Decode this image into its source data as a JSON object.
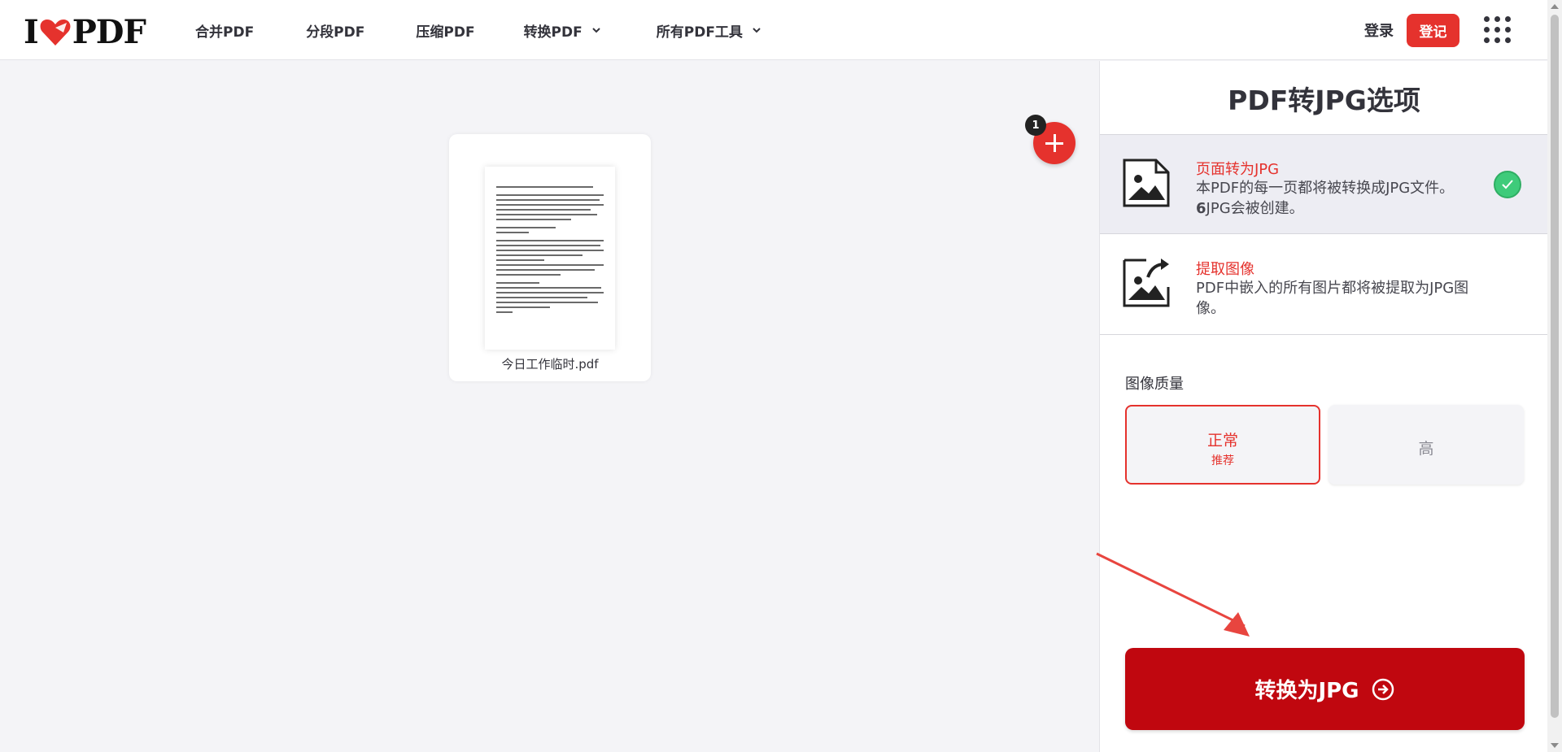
{
  "header": {
    "logo": {
      "left": "I",
      "right": "PDF"
    },
    "nav": [
      {
        "label": "合并PDF",
        "dropdown": false
      },
      {
        "label": "分段PDF",
        "dropdown": false
      },
      {
        "label": "压缩PDF",
        "dropdown": false
      },
      {
        "label": "转换PDF",
        "dropdown": true
      },
      {
        "label": "所有PDF工具",
        "dropdown": true
      }
    ],
    "login_label": "登录",
    "signup_label": "登记"
  },
  "workspace": {
    "file_name": "今日工作临时.pdf",
    "file_count_badge": "1"
  },
  "sidebar": {
    "title": "PDF转JPG选项",
    "options": [
      {
        "title": "页面转为JPG",
        "desc_prefix": "本PDF的每一页都将被转换成JPG文件。",
        "desc_count": "6",
        "desc_suffix": "JPG会被创建。",
        "selected": true
      },
      {
        "title": "提取图像",
        "desc": "PDF中嵌入的所有图片都将被提取为JPG图像。",
        "selected": false
      }
    ],
    "quality": {
      "label": "图像质量",
      "normal": {
        "label": "正常",
        "sub": "推荐"
      },
      "high": {
        "label": "高"
      }
    },
    "convert_label": "转换为JPG"
  },
  "colors": {
    "accent": "#e5322d",
    "convert": "#c0070f",
    "check": "#3ecb7a"
  }
}
